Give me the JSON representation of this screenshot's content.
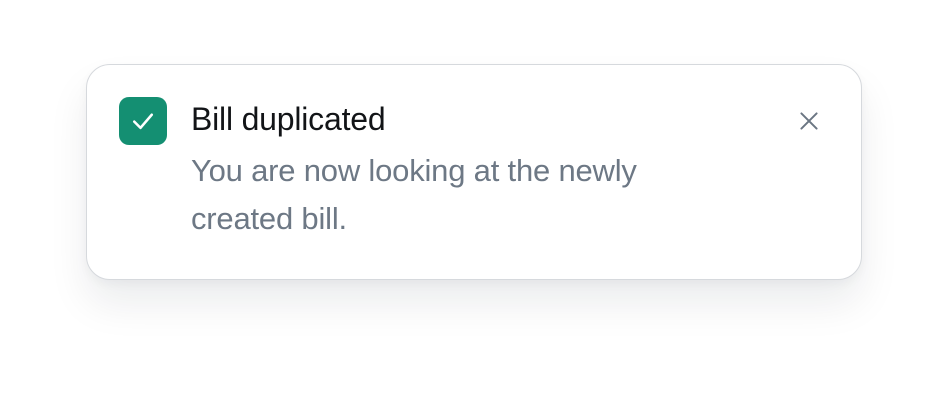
{
  "toast": {
    "title": "Bill duplicated",
    "message": "You are now looking at the newly created bill.",
    "status": "success",
    "status_icon": "check-icon",
    "close_icon": "close-icon",
    "accent_color": "#148f72"
  }
}
